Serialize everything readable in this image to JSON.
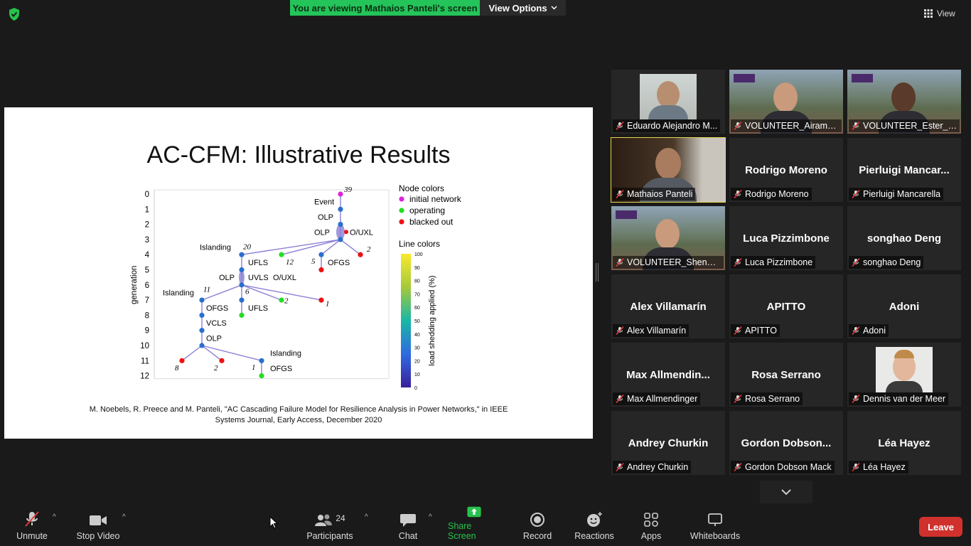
{
  "banner": {
    "viewing_text": "You are viewing Mathaios Panteli's screen",
    "view_options": "View Options",
    "view": "View"
  },
  "slide": {
    "title": "AC-CFM: Illustrative Results",
    "citation_line1": "M. Noebels, R. Preece and M. Panteli, \"AC Cascading Failure Model for Resilience Analysis in Power Networks,\" in IEEE",
    "citation_line2": "Systems Journal, Early Access, December 2020"
  },
  "chart_data": {
    "type": "diagram",
    "ylabel": "generation",
    "y_ticks": [
      "0",
      "1",
      "2",
      "3",
      "4",
      "5",
      "6",
      "7",
      "8",
      "9",
      "10",
      "11",
      "12"
    ],
    "legend_node_title": "Node colors",
    "legend_nodes": [
      {
        "label": "initial network",
        "color": "#e020e0"
      },
      {
        "label": "operating",
        "color": "#22dd22"
      },
      {
        "label": "blacked out",
        "color": "#ee1111"
      }
    ],
    "legend_line_title": "Line colors",
    "colorbar_label": "load shedding applied (%)",
    "colorbar_ticks": [
      "0",
      "10",
      "20",
      "30",
      "40",
      "50",
      "60",
      "70",
      "80",
      "90",
      "100"
    ],
    "annotations": [
      "Event",
      "OLP",
      "OLP",
      "O/UXL",
      "Islanding",
      "UFLS",
      "OFGS",
      "OLP",
      "UVLS",
      "O/UXL",
      "Islanding",
      "UFLS",
      "OFGS",
      "VCLS",
      "OLP",
      "Islanding",
      "OFGS"
    ],
    "numbers": [
      "39",
      "2",
      "20",
      "12",
      "5",
      "6",
      "2",
      "1",
      "11",
      "8",
      "2",
      "1"
    ]
  },
  "participants": [
    {
      "display": "",
      "caption": "Eduardo Alejandro M...",
      "video": true,
      "active": false
    },
    {
      "display": "",
      "caption": "VOLUNTEER_Airam_P...",
      "video": true,
      "active": false
    },
    {
      "display": "",
      "caption": "VOLUNTEER_Ester_M...",
      "video": true,
      "active": false
    },
    {
      "display": "",
      "caption": "Mathaios Panteli",
      "video": true,
      "active": true
    },
    {
      "display": "Rodrigo Moreno",
      "caption": "Rodrigo Moreno",
      "video": false
    },
    {
      "display": "Pierluigi  Mancar...",
      "caption": "Pierluigi Mancarella",
      "video": false
    },
    {
      "display": "",
      "caption": "VOLUNTEER_Shengye...",
      "video": true
    },
    {
      "display": "Luca Pizzimbone",
      "caption": "Luca Pizzimbone",
      "video": false
    },
    {
      "display": "songhao Deng",
      "caption": "songhao Deng",
      "video": false
    },
    {
      "display": "Alex Villamarín",
      "caption": "Alex Villamarín",
      "video": false
    },
    {
      "display": "APITTO",
      "caption": "APITTO",
      "video": false
    },
    {
      "display": "Adoni",
      "caption": "Adoni",
      "video": false
    },
    {
      "display": "Max  Allmendin...",
      "caption": "Max Allmendinger",
      "video": false
    },
    {
      "display": "Rosa Serrano",
      "caption": "Rosa Serrano",
      "video": false
    },
    {
      "display": "",
      "caption": "Dennis van der Meer",
      "video": true
    },
    {
      "display": "Andrey Churkin",
      "caption": "Andrey Churkin",
      "video": false
    },
    {
      "display": "Gordon  Dobson...",
      "caption": "Gordon Dobson Mack",
      "video": false
    },
    {
      "display": "Léa Hayez",
      "caption": "Léa Hayez",
      "video": false
    }
  ],
  "toolbar": {
    "unmute": "Unmute",
    "stop_video": "Stop Video",
    "participants": "Participants",
    "participants_count": "24",
    "chat": "Chat",
    "share_screen": "Share Screen",
    "record": "Record",
    "reactions": "Reactions",
    "apps": "Apps",
    "whiteboards": "Whiteboards",
    "leave": "Leave"
  },
  "colors": {
    "banner": "#24c45a",
    "active_speaker": "#e8d64b",
    "leave": "#d0312d",
    "share": "#27c24c"
  }
}
